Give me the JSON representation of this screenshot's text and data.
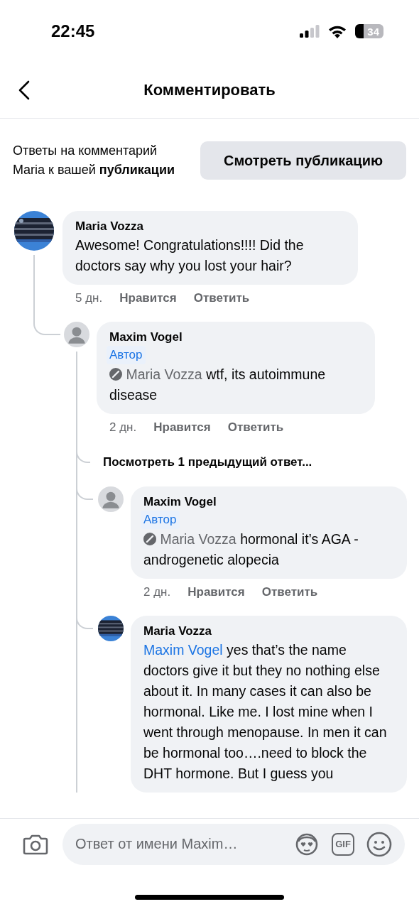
{
  "status_bar": {
    "time": "22:45",
    "battery": "34"
  },
  "header": {
    "title": "Комментировать"
  },
  "context": {
    "text": "Ответы на комментарий Maria к вашей **публикации**",
    "button": "Смотреть публикацию"
  },
  "comments": [
    {
      "author": "Maria Vozza",
      "avatar": {
        "kind": "picture"
      },
      "text": "Awesome! Congratulations!!!! Did the doctors say why you lost your hair?",
      "time": "5 дн.",
      "actions": [
        "Нравится",
        "Ответить"
      ],
      "children": [
        {
          "author": "Maxim Vogel",
          "avatar": {
            "kind": "person"
          },
          "badge": "Автор",
          "mention": {
            "name": "Maria Vozza",
            "kind": "removed"
          },
          "text": "wtf, its autoimmune disease",
          "time": "2 дн.",
          "actions": [
            "Нравится",
            "Ответить"
          ],
          "more_replies": "Посмотреть 1 предыдущий ответ...",
          "children": [
            {
              "author": "Maxim Vogel",
              "avatar": {
                "kind": "person"
              },
              "badge": "Автор",
              "mention": {
                "name": "Maria Vozza",
                "kind": "removed"
              },
              "text": "hormonal it’s AGA - androgenetic alopecia",
              "time": "2 дн.",
              "actions": [
                "Нравится",
                "Ответить"
              ]
            },
            {
              "author": "Maria Vozza",
              "avatar": {
                "kind": "picture"
              },
              "mention": {
                "name": "Maxim Vogel",
                "kind": "link"
              },
              "text": "yes that’s the name doctors give it but they no nothing else about it. In many cases it can also be hormonal. Like me. I lost mine when I went through menopause. In men it can be hormonal too….need to block the DHT hormone. But I guess you"
            }
          ]
        }
      ]
    }
  ],
  "composer": {
    "placeholder": "Ответ от имени Maxim…",
    "gif": "GIF"
  }
}
